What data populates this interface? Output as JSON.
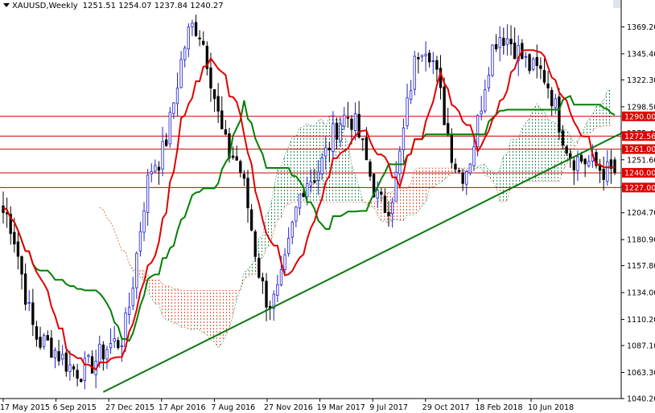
{
  "header": {
    "symbol": "XAUUSD,Weekly",
    "ohlc": "1251.51 1254.07 1237.84 1240.27"
  },
  "colors": {
    "background": "#ffffff",
    "axis": "#000000",
    "candle_up": "#1f1fd0",
    "candle_down": "#000000",
    "tenkan": "#e00000",
    "kijun": "#008000",
    "cloud_bear": "#e8563a",
    "cloud_bull": "#2e8b57",
    "level_line": "#cc0000",
    "label_bg": "#e00000",
    "label_text": "#ffffff",
    "trendline": "#0a7a0a"
  },
  "chart_data": {
    "type": "candlestick",
    "title": "XAUUSD,Weekly",
    "y_ticks": [
      "1369.20",
      "1345.40",
      "1322.30",
      "1298.50",
      "1275.40",
      "1251.60",
      "1227.80",
      "1204.70",
      "1180.90",
      "1157.80",
      "1134.00",
      "1110.20",
      "1087.10",
      "1063.30",
      "1040.20"
    ],
    "ylim": [
      1040.2,
      1393.0
    ],
    "x_ticks": [
      "17 May 2015",
      "6 Sep 2015",
      "27 Dec 2015",
      "17 Apr 2016",
      "7 Aug 2016",
      "27 Nov 2016",
      "19 Mar 2017",
      "9 Jul 2017",
      "29 Oct 2017",
      "18 Feb 2018",
      "10 Jun 2018"
    ],
    "price_levels": [
      {
        "value": 1290.0,
        "label": "1290.00"
      },
      {
        "value": 1272.56,
        "label": "1272.56"
      },
      {
        "value": 1261.0,
        "label": "1261.00"
      },
      {
        "value": 1240.0,
        "label": "1240.00"
      },
      {
        "value": 1227.0,
        "label": "1227.00"
      }
    ],
    "last_price": {
      "open": 1251.51,
      "high": 1254.07,
      "low": 1237.84,
      "close": 1240.27
    },
    "trendline": {
      "from": {
        "date": "late Nov 2015",
        "price": 1046.0
      },
      "to": {
        "date": "Jul 2018",
        "price": 1275.0
      }
    },
    "keypoints": [
      {
        "date": "May 2015",
        "price": 1205
      },
      {
        "date": "Aug 2015",
        "price": 1090
      },
      {
        "date": "Nov 2015",
        "price": 1065
      },
      {
        "date": "Jan 2016",
        "price": 1090
      },
      {
        "date": "Mar 2016",
        "price": 1250
      },
      {
        "date": "Jul 2016",
        "price": 1370
      },
      {
        "date": "Oct 2016",
        "price": 1255
      },
      {
        "date": "Dec 2016",
        "price": 1125
      },
      {
        "date": "Feb 2017",
        "price": 1235
      },
      {
        "date": "Apr 2017",
        "price": 1290
      },
      {
        "date": "Jul 2017",
        "price": 1210
      },
      {
        "date": "Sep 2017",
        "price": 1355
      },
      {
        "date": "Dec 2017",
        "price": 1240
      },
      {
        "date": "Jan 2018",
        "price": 1362
      },
      {
        "date": "Apr 2018",
        "price": 1330
      },
      {
        "date": "Jun 2018",
        "price": 1252
      },
      {
        "date": "Jul 2018",
        "price": 1240
      }
    ]
  }
}
